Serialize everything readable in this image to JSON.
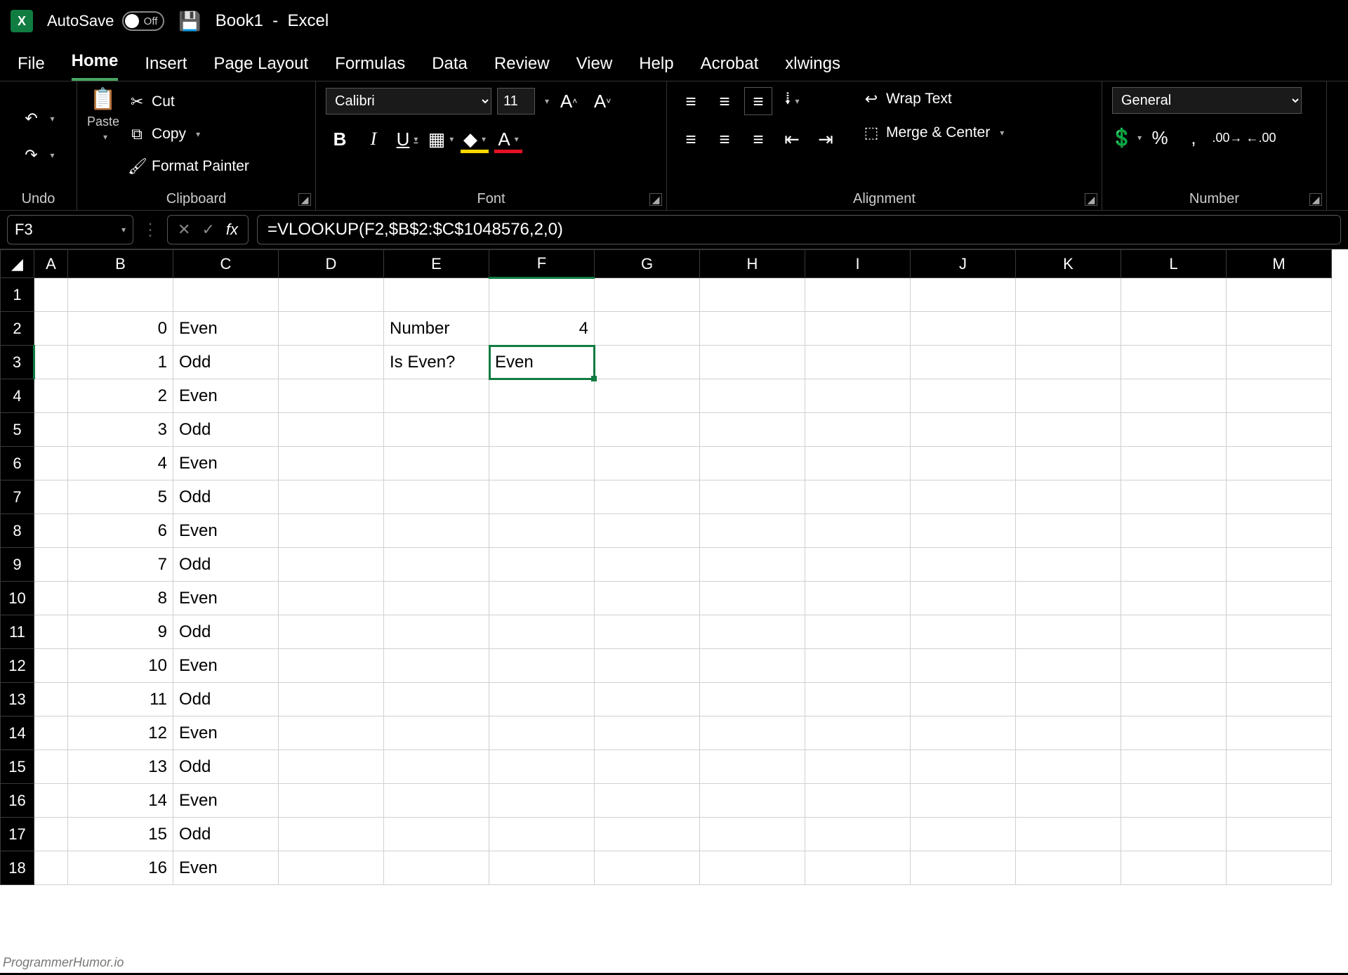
{
  "title": {
    "autosave_label": "AutoSave",
    "autosave_state": "Off",
    "doc": "Book1",
    "app": "Excel"
  },
  "tabs": [
    "File",
    "Home",
    "Insert",
    "Page Layout",
    "Formulas",
    "Data",
    "Review",
    "View",
    "Help",
    "Acrobat",
    "xlwings"
  ],
  "active_tab": 1,
  "ribbon": {
    "undo": {
      "title": "Undo"
    },
    "clipboard": {
      "title": "Clipboard",
      "paste": "Paste",
      "cut": "Cut",
      "copy": "Copy",
      "painter": "Format Painter"
    },
    "font": {
      "title": "Font",
      "name": "Calibri",
      "size": "11"
    },
    "align": {
      "title": "Alignment",
      "wrap": "Wrap Text",
      "merge": "Merge & Center"
    },
    "number": {
      "title": "Number",
      "format": "General"
    }
  },
  "formula_bar": {
    "cell_ref": "F3",
    "formula": "=VLOOKUP(F2,$B$2:$C$1048576,2,0)"
  },
  "columns": [
    "A",
    "B",
    "C",
    "D",
    "E",
    "F",
    "G",
    "H",
    "I",
    "J",
    "K",
    "L",
    "M"
  ],
  "selected_col": "F",
  "selected_row": 3,
  "rows": [
    1,
    2,
    3,
    4,
    5,
    6,
    7,
    8,
    9,
    10,
    11,
    12,
    13,
    14,
    15,
    16,
    17,
    18
  ],
  "cells": {
    "B2": "0",
    "C2": "Even",
    "E2": "Number",
    "F2": "4",
    "B3": "1",
    "C3": "Odd",
    "E3": "Is Even?",
    "F3": "Even",
    "B4": "2",
    "C4": "Even",
    "B5": "3",
    "C5": "Odd",
    "B6": "4",
    "C6": "Even",
    "B7": "5",
    "C7": "Odd",
    "B8": "6",
    "C8": "Even",
    "B9": "7",
    "C9": "Odd",
    "B10": "8",
    "C10": "Even",
    "B11": "9",
    "C11": "Odd",
    "B12": "10",
    "C12": "Even",
    "B13": "11",
    "C13": "Odd",
    "B14": "12",
    "C14": "Even",
    "B15": "13",
    "C15": "Odd",
    "B16": "14",
    "C16": "Even",
    "B17": "15",
    "C17": "Odd",
    "B18": "16",
    "C18": "Even"
  },
  "numeric_cells": [
    "B2",
    "B3",
    "B4",
    "B5",
    "B6",
    "B7",
    "B8",
    "B9",
    "B10",
    "B11",
    "B12",
    "B13",
    "B14",
    "B15",
    "B16",
    "B17",
    "B18",
    "F2"
  ],
  "watermark": "ProgrammerHumor.io"
}
